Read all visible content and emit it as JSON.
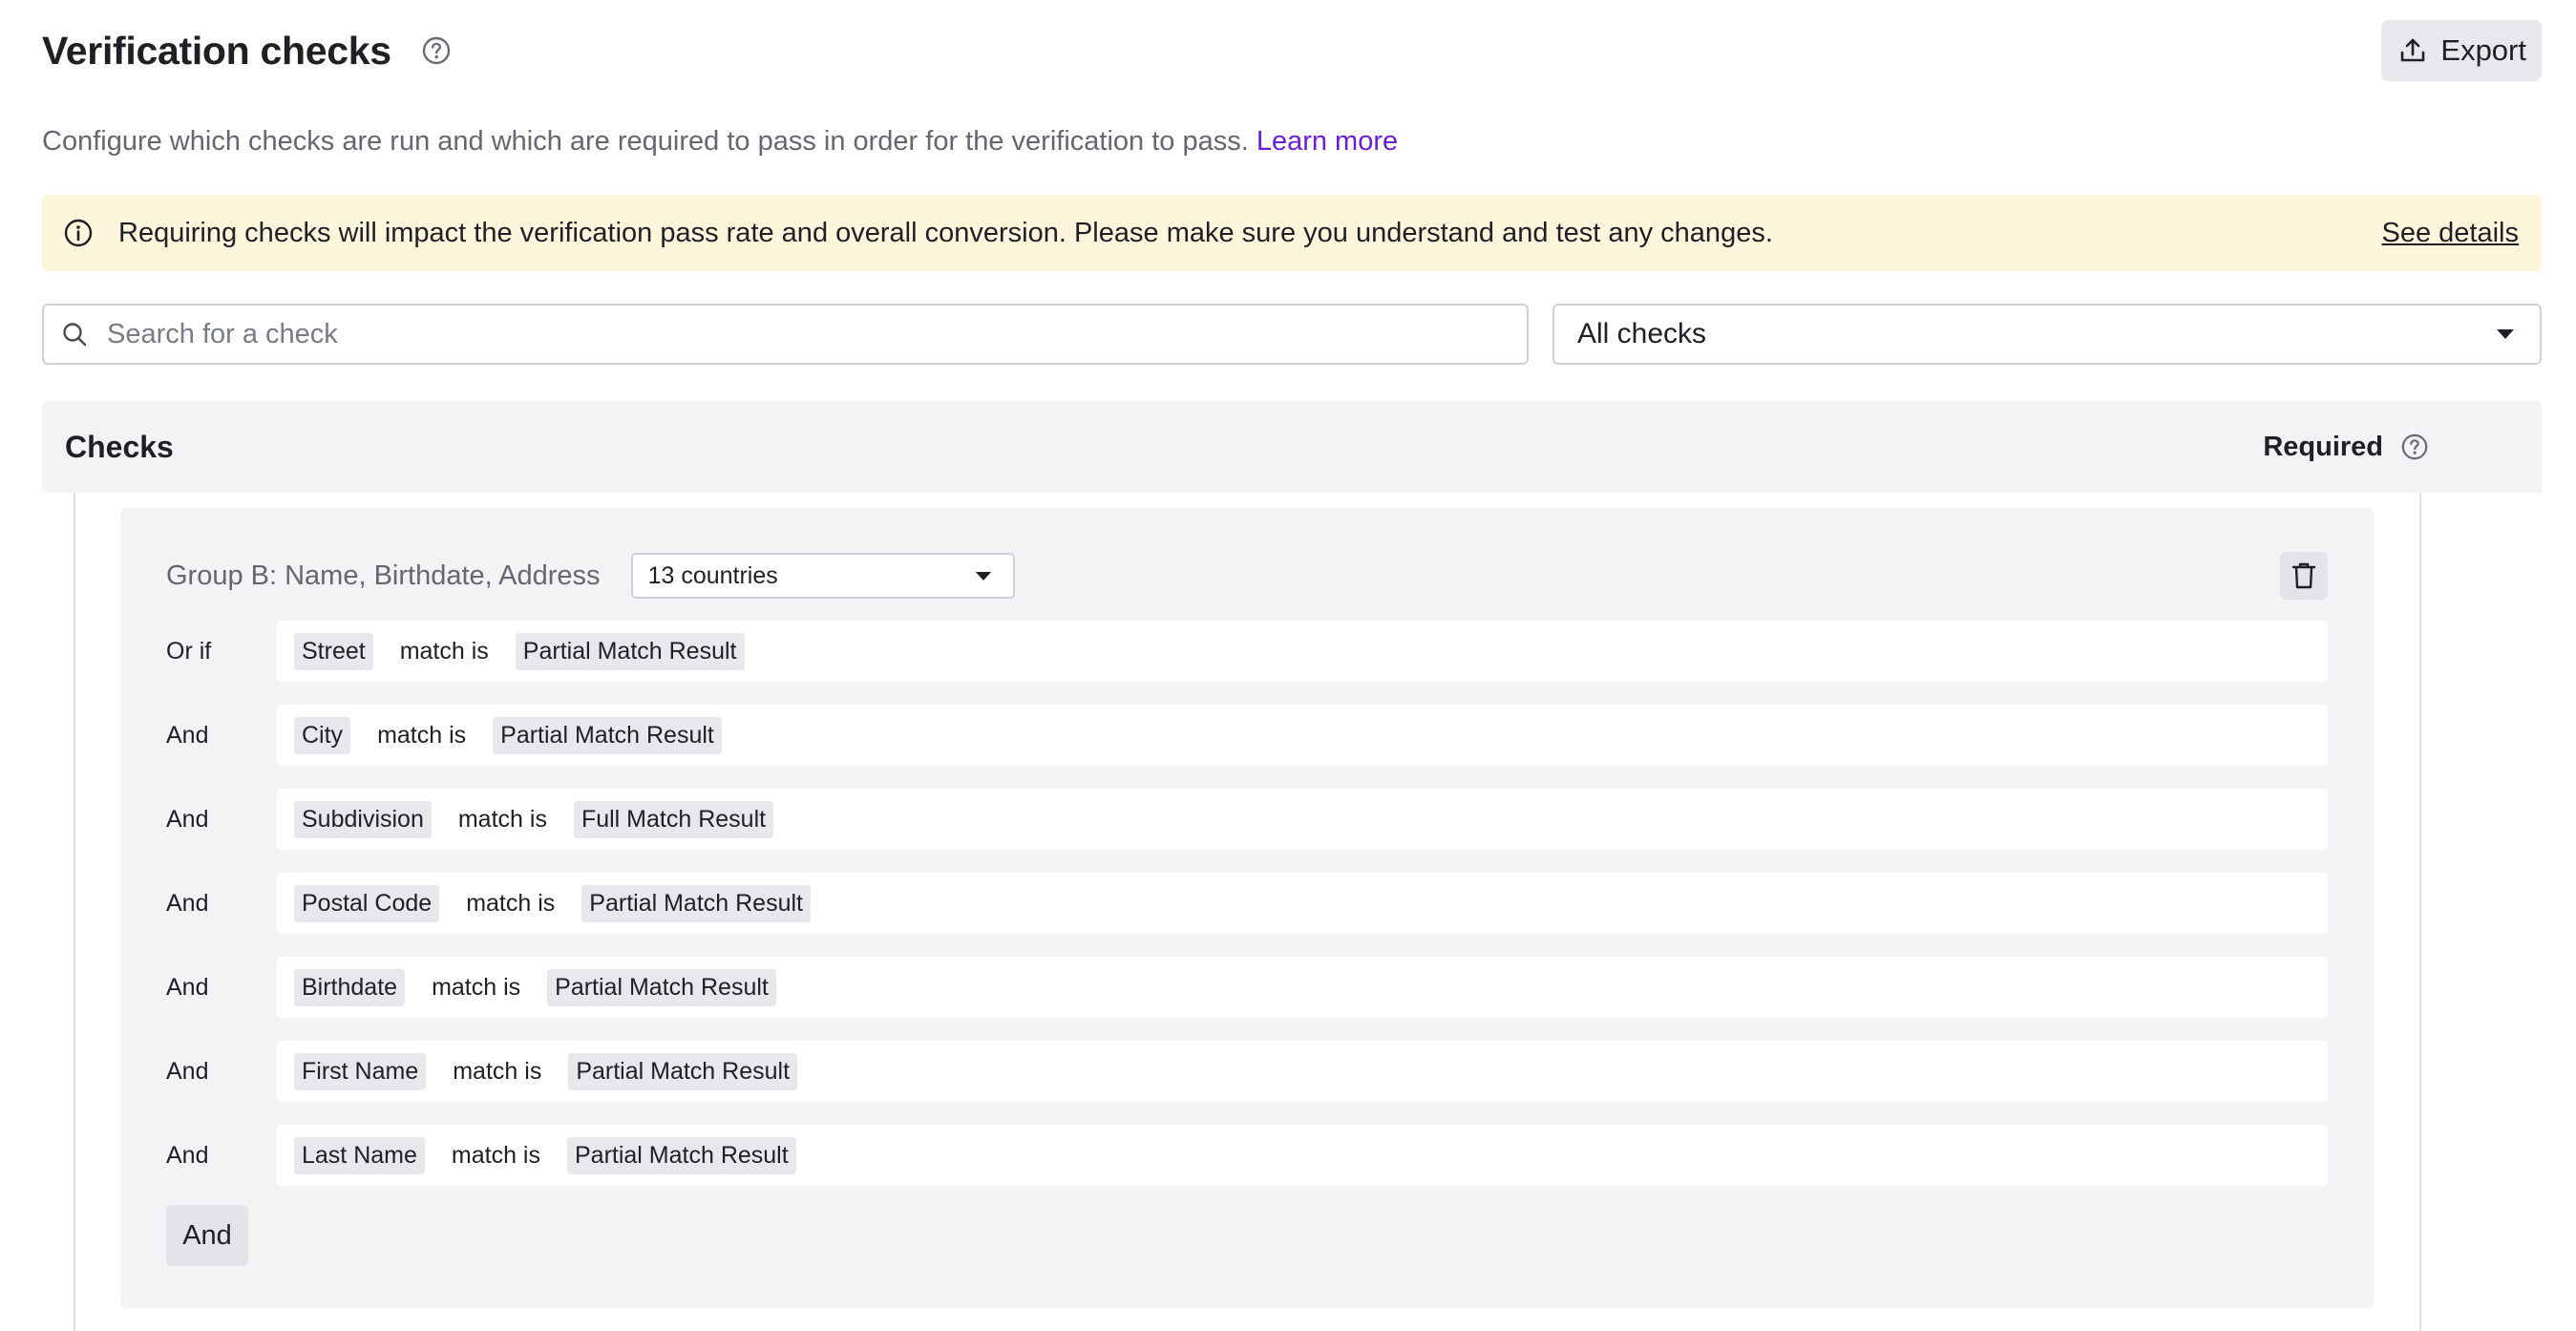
{
  "header": {
    "title": "Verification checks",
    "export_label": "Export"
  },
  "description": {
    "text": "Configure which checks are run and which are required to pass in order for the verification to pass.",
    "link": "Learn more"
  },
  "banner": {
    "text": "Requiring checks will impact the verification pass rate and overall conversion. Please make sure you understand and test any changes.",
    "link": "See details"
  },
  "search": {
    "placeholder": "Search for a check",
    "value": ""
  },
  "filter": {
    "selected": "All checks"
  },
  "checks_table": {
    "title": "Checks",
    "required_label": "Required"
  },
  "group": {
    "label": "Group B: Name, Birthdate, Address",
    "countries": "13 countries",
    "and_button": "And",
    "conditions": [
      {
        "op": "Or if",
        "field": "Street",
        "text": "match is",
        "result": "Partial Match Result"
      },
      {
        "op": "And",
        "field": "City",
        "text": "match is",
        "result": "Partial Match Result"
      },
      {
        "op": "And",
        "field": "Subdivision",
        "text": "match is",
        "result": "Full Match Result"
      },
      {
        "op": "And",
        "field": "Postal Code",
        "text": "match is",
        "result": "Partial Match Result"
      },
      {
        "op": "And",
        "field": "Birthdate",
        "text": "match is",
        "result": "Partial Match Result"
      },
      {
        "op": "And",
        "field": "First Name",
        "text": "match is",
        "result": "Partial Match Result"
      },
      {
        "op": "And",
        "field": "Last Name",
        "text": "match is",
        "result": "Partial Match Result"
      }
    ]
  },
  "colors": {
    "accent_link": "#6a1fd6",
    "banner_bg": "#fdf5dc",
    "panel_bg": "#f3f3f5"
  },
  "icons": {
    "title_help": "help-circle-icon",
    "export": "upload-icon",
    "banner": "info-icon",
    "search": "search-icon",
    "filter_caret": "caret-down-icon",
    "required_help": "help-circle-icon",
    "country_caret": "caret-down-icon",
    "delete": "trash-icon"
  }
}
